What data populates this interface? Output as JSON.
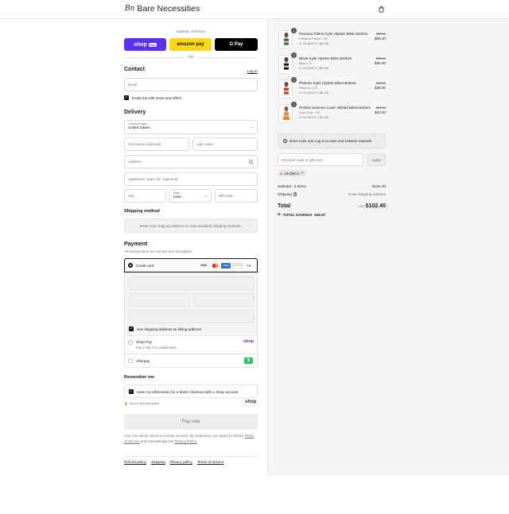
{
  "header": {
    "brand": "Bare Necessities",
    "brand_mark": "Bn"
  },
  "express": {
    "title": "Express checkout",
    "shop_pay": "shop",
    "shop_pay_badge": "Pay",
    "amazon_pay": "amazon pay",
    "google_pay": "G Pay",
    "or": "OR"
  },
  "contact": {
    "title": "Contact",
    "login": "Log in",
    "email_placeholder": "Email",
    "news_label": "Email me with news and offers"
  },
  "delivery": {
    "title": "Delivery",
    "country_label": "Country/Region",
    "country_value": "United States",
    "first_name": "First name (optional)",
    "last_name": "Last name",
    "address": "Address",
    "apartment": "Apartment, suite, etc. (optional)",
    "city": "City",
    "state_label": "State",
    "state_value": "Iowa",
    "zip": "ZIP code"
  },
  "shipping": {
    "title": "Shipping method",
    "notice": "Enter your shipping address to view available shipping methods."
  },
  "payment": {
    "title": "Payment",
    "subtitle": "All transactions are secure and encrypted.",
    "credit_card": "Credit card",
    "card_more": "+4",
    "card_brands": [
      "VISA",
      "MC",
      "AMEX",
      "DISCOVER"
    ],
    "billing_label": "Use shipping address as billing address",
    "shop_pay_title": "Shop Pay",
    "shop_pay_sub": "Pay in full or in installments",
    "shop_pay_logo": "shop",
    "afterpay": "Afterpay",
    "afterpay_badge": "$"
  },
  "remember": {
    "title": "Remember me",
    "label": "Save my information for a faster checkout with a Shop account",
    "secure": "Secure and encrypted",
    "shop_logo": "shop"
  },
  "pay_button": "Pay now",
  "legal": {
    "line1": "Your info will be saved to a Shop account. By continuing, you agree to Shop's",
    "terms": "Terms of Service",
    "and": "and acknowledge the",
    "privacy": "Privacy Policy."
  },
  "footer_links": [
    "Refund policy",
    "Shipping",
    "Privacy policy",
    "Terms of service"
  ],
  "cart": {
    "items": [
      {
        "qty": "1",
        "name": "Panama Palms Kylie Hipster Bikini Bottom",
        "variant": "Panama Palms / XS",
        "discount": "20-QMCV (-$6.60)",
        "old_price": "$32.00",
        "price": "$26.40"
      },
      {
        "qty": "1",
        "name": "Black Kylie Hipster Bikini Bottom",
        "variant": "Black / S",
        "discount": "20-QMCV (-$9.00)",
        "old_price": "$45.00",
        "price": "$36.00"
      },
      {
        "qty": "1",
        "name": "Phoenix Kylie Hipster Bikini Bottom",
        "variant": "Phoenix / XS",
        "discount": "20-QMCV (-$6.00)",
        "old_price": "$34.00",
        "price": "$26.00"
      },
      {
        "qty": "1",
        "name": "Printed Summer Lovin' Skirted Bikini Bottom",
        "variant": "Lush Lido / XS",
        "discount": "20-QMCV (-$4.99)",
        "old_price": "$24.99",
        "price": "$20.00"
      }
    ],
    "rewards": "Don't miss out! Log in to earn and redeem rewards",
    "discount_placeholder": "Discount code or gift card",
    "apply": "Apply",
    "code": "20-QMCV",
    "subtotal_label": "Subtotal · 4 items",
    "subtotal_value": "$102.40",
    "shipping_label": "Shipping",
    "shipping_value": "Enter shipping address",
    "total_label": "Total",
    "currency": "USD",
    "total_value": "$102.40",
    "savings_label": "TOTAL SAVINGS",
    "savings_value": "$25.57"
  },
  "colors": {
    "shop_pay": "#5a31f4",
    "amazon": "#ffd814",
    "afterpay": "#2ec25f",
    "shop_logo": "#5a31f4"
  }
}
